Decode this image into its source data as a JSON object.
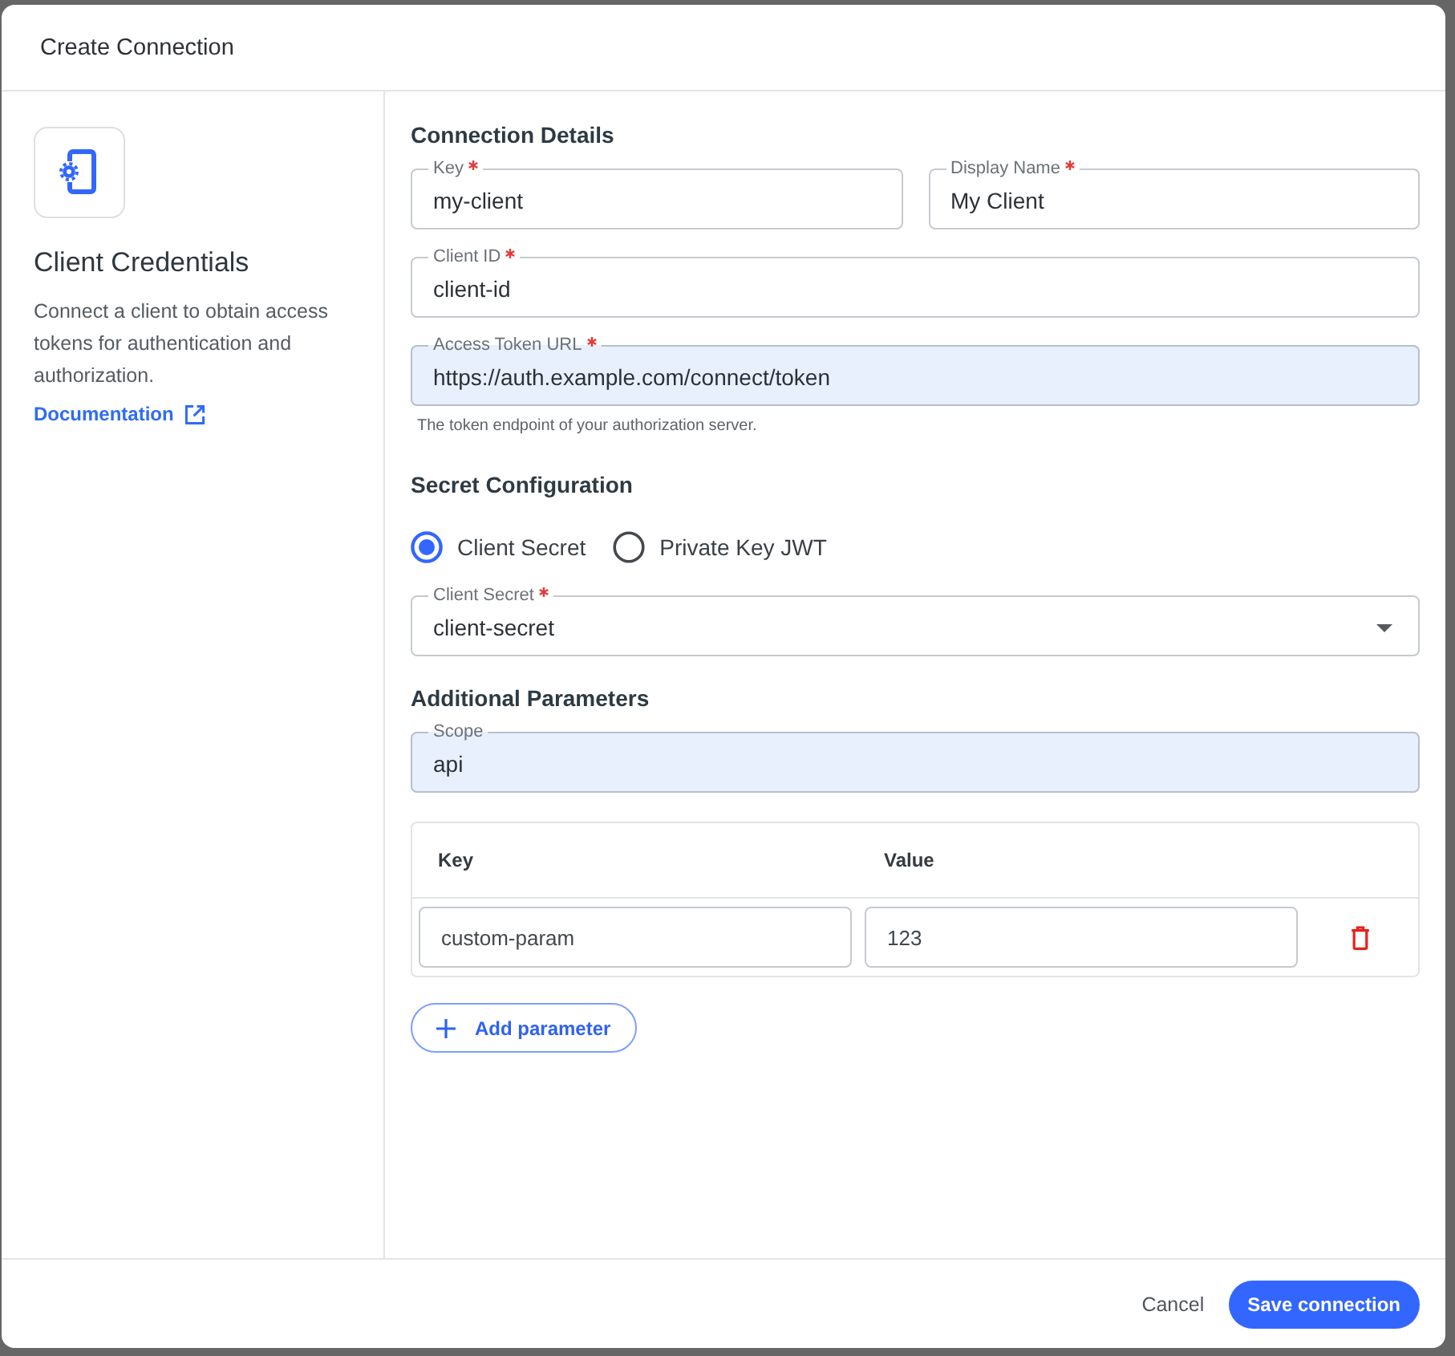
{
  "dialog": {
    "title": "Create Connection"
  },
  "sidebar": {
    "title": "Client Credentials",
    "description": "Connect a client to obtain access tokens for authentication and authorization.",
    "link": "Documentation"
  },
  "connection_details": {
    "heading": "Connection Details",
    "rows": [
      [
        {
          "label": "Key",
          "required": true,
          "value": "my-client",
          "autofilled": false
        },
        {
          "label": "Display Name",
          "required": true,
          "value": "My Client",
          "autofilled": false
        }
      ],
      [
        {
          "label": "Client ID",
          "required": true,
          "value": "client-id",
          "autofilled": false
        }
      ],
      [
        {
          "label": "Access Token URL",
          "required": true,
          "value": "https://auth.example.com/connect/token",
          "autofilled": true,
          "helper_text": "The token endpoint of your authorization server."
        }
      ]
    ]
  },
  "secret_configuration": {
    "heading": "Secret Configuration",
    "options": [
      {
        "label": "Client Secret",
        "selected": true
      },
      {
        "label": "Private Key JWT",
        "selected": false
      }
    ],
    "select": {
      "label": "Client Secret",
      "required": true,
      "value": "client-secret"
    }
  },
  "additional_parameters": {
    "heading": "Additional Parameters",
    "scope": {
      "label": "Scope",
      "required": false,
      "value": "api",
      "autofilled": true
    },
    "table": {
      "columns": [
        "Key",
        "Value"
      ],
      "rows": [
        {
          "key": "custom-param",
          "value": "123"
        }
      ]
    },
    "add_button": "Add parameter"
  },
  "footer": {
    "buttons": [
      {
        "label": "Cancel",
        "kind": "secondary"
      },
      {
        "label": "Save connection",
        "kind": "primary"
      }
    ]
  }
}
